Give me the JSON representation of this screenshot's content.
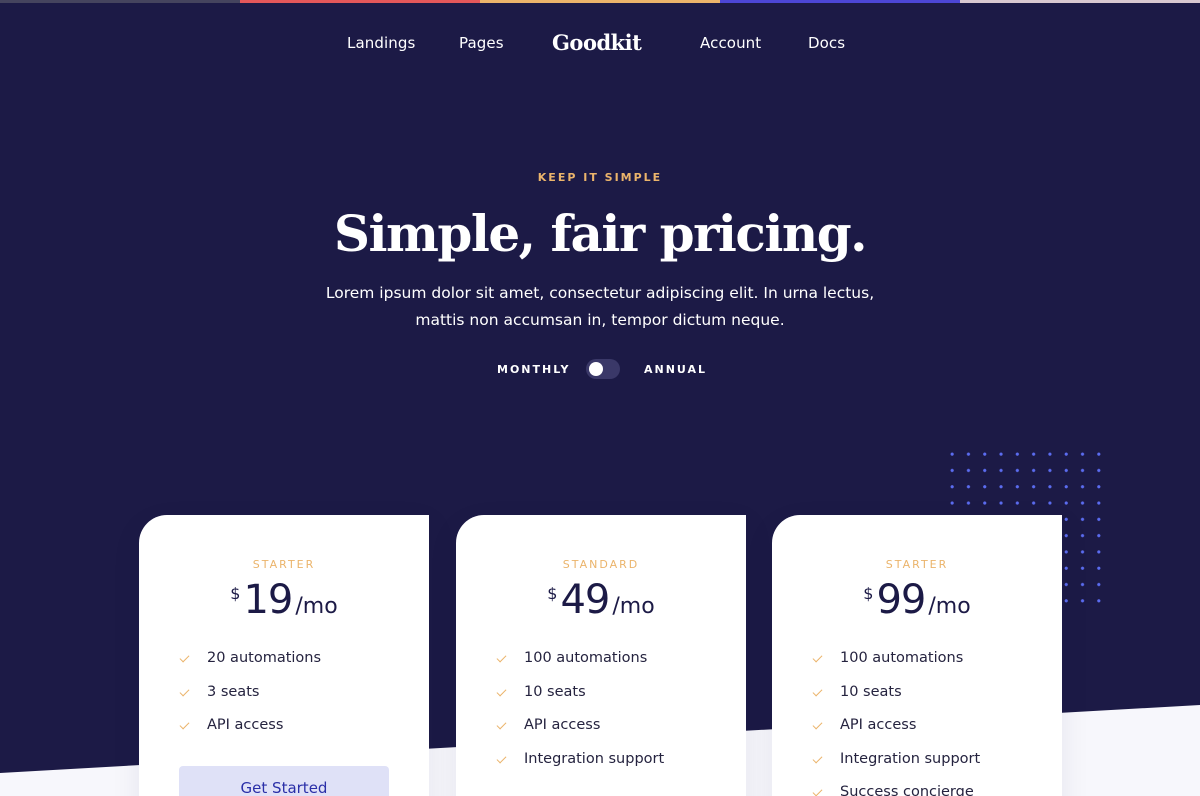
{
  "colors": {
    "background": "#1c1a46",
    "accent": "#ebb46b",
    "top_stripes": [
      "#45445e",
      "#e4575a",
      "#ebb46b",
      "#4c46d6",
      "#d8c8d0"
    ]
  },
  "nav": {
    "logo": "Goodkit",
    "items": [
      "Landings",
      "Pages",
      "Account",
      "Docs"
    ]
  },
  "hero": {
    "eyebrow": "KEEP IT SIMPLE",
    "title": "Simple, fair pricing.",
    "subtitle": "Lorem ipsum dolor sit amet, consectetur adipiscing elit. In urna lectus, mattis non accumsan in, tempor dictum neque."
  },
  "billing_toggle": {
    "left_label": "MONTHLY",
    "right_label": "ANNUAL",
    "selected": "MONTHLY"
  },
  "plans": [
    {
      "name": "STARTER",
      "currency": "$",
      "price": "19",
      "period": "/mo",
      "features": [
        "20 automations",
        "3 seats",
        "API access"
      ],
      "cta": "Get Started"
    },
    {
      "name": "STANDARD",
      "currency": "$",
      "price": "49",
      "period": "/mo",
      "features": [
        "100 automations",
        "10 seats",
        "API access",
        "Integration support"
      ]
    },
    {
      "name": "STARTER",
      "currency": "$",
      "price": "99",
      "period": "/mo",
      "features": [
        "100 automations",
        "10 seats",
        "API access",
        "Integration support",
        "Success concierge"
      ]
    }
  ]
}
